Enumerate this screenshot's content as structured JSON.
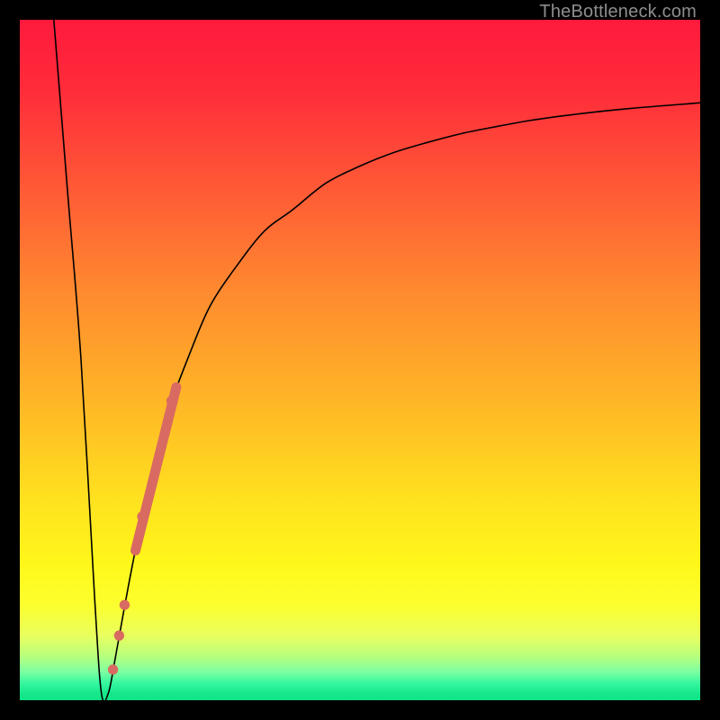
{
  "watermark": "TheBottleneck.com",
  "colors": {
    "frame": "#000000",
    "curve": "#000000",
    "marker": "#d96a61",
    "gradient_stops": [
      {
        "offset": 0.0,
        "color": "#ff1a3c"
      },
      {
        "offset": 0.1,
        "color": "#ff2b3a"
      },
      {
        "offset": 0.25,
        "color": "#ff5a36"
      },
      {
        "offset": 0.4,
        "color": "#ff8a2f"
      },
      {
        "offset": 0.55,
        "color": "#ffb327"
      },
      {
        "offset": 0.7,
        "color": "#ffe01f"
      },
      {
        "offset": 0.8,
        "color": "#fff71a"
      },
      {
        "offset": 0.86,
        "color": "#fcff2e"
      },
      {
        "offset": 0.905,
        "color": "#e9ff5e"
      },
      {
        "offset": 0.935,
        "color": "#b8ff7d"
      },
      {
        "offset": 0.958,
        "color": "#7dffa1"
      },
      {
        "offset": 0.975,
        "color": "#36f7a0"
      },
      {
        "offset": 0.99,
        "color": "#17e78b"
      },
      {
        "offset": 1.0,
        "color": "#11e487"
      }
    ]
  },
  "chart_data": {
    "type": "line",
    "title": "",
    "xlabel": "",
    "ylabel": "",
    "xlim": [
      0,
      100
    ],
    "ylim": [
      0,
      100
    ],
    "note": "Y values are percentages (V-shaped bottleneck curve). Left branch drops from ~100 at x≈5 to ~0 at x≈12; right branch rises asymptotically toward ~88 by x=100.",
    "series": [
      {
        "name": "bottleneck-curve",
        "x": [
          5,
          7,
          9,
          11,
          12,
          13,
          14,
          16,
          18,
          20,
          22,
          25,
          28,
          32,
          36,
          40,
          45,
          50,
          55,
          60,
          65,
          70,
          75,
          80,
          85,
          90,
          95,
          100
        ],
        "y": [
          100,
          75,
          50,
          15,
          1,
          1,
          6,
          17,
          27,
          36,
          43,
          51,
          58,
          64,
          69,
          72,
          76,
          78.5,
          80.5,
          82,
          83.3,
          84.3,
          85.2,
          85.9,
          86.5,
          87,
          87.4,
          87.8
        ]
      }
    ],
    "markers": {
      "name": "highlighted-range",
      "color": "#d96a61",
      "points_xy": [
        [
          13.7,
          4.5
        ],
        [
          14.6,
          9.5
        ],
        [
          15.4,
          14.0
        ],
        [
          18.0,
          27.0
        ],
        [
          22.3,
          44.0
        ]
      ],
      "thick_segment": {
        "x0": 17.0,
        "y0": 22.0,
        "x1": 23.0,
        "y1": 46.0
      }
    }
  }
}
